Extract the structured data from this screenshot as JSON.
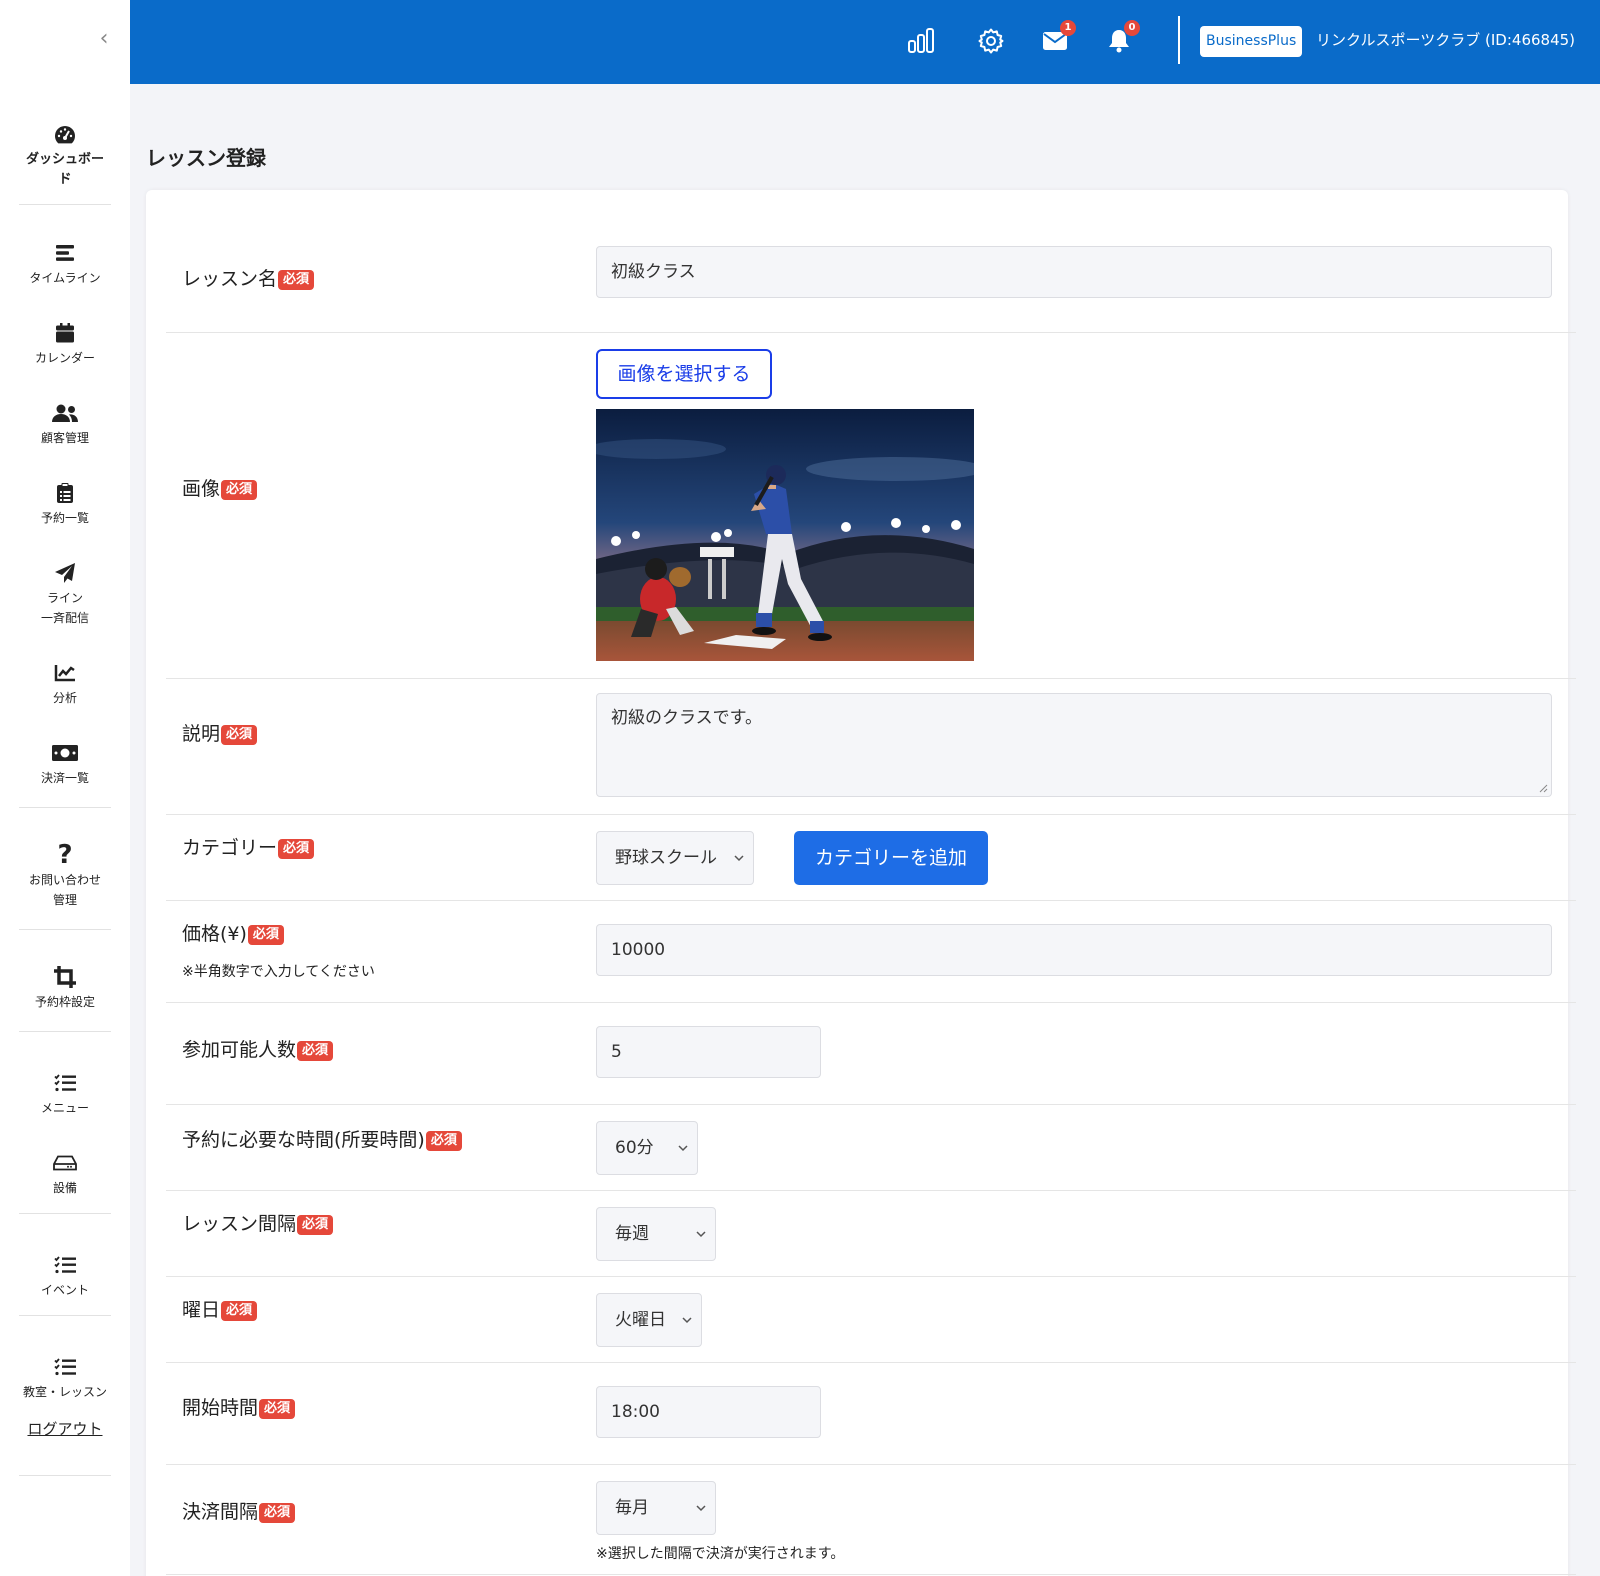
{
  "sidebar": {
    "items": [
      {
        "label": "ダッシュボード",
        "icon": "dashboard-icon"
      },
      {
        "label": "タイムライン",
        "icon": "timeline-icon"
      },
      {
        "label": "カレンダー",
        "icon": "calendar-icon"
      },
      {
        "label": "顧客管理",
        "icon": "users-icon"
      },
      {
        "label": "予約一覧",
        "icon": "clipboard-icon"
      },
      {
        "label": "ライン",
        "label2": "一斉配信",
        "icon": "paper-plane-icon"
      },
      {
        "label": "分析",
        "icon": "chart-line-icon"
      },
      {
        "label": "決済一覧",
        "icon": "money-icon"
      },
      {
        "label": "お問い合わせ",
        "label2": "管理",
        "icon": "question-icon"
      },
      {
        "label": "予約枠設定",
        "icon": "crop-icon"
      },
      {
        "label": "メニュー",
        "icon": "list-check-icon"
      },
      {
        "label": "設備",
        "icon": "hdd-icon"
      },
      {
        "label": "イベント",
        "icon": "list-check-icon"
      },
      {
        "label": "教室・レッスン",
        "icon": "list-check-icon"
      }
    ],
    "logout": "ログアウト"
  },
  "topbar": {
    "mail_count": "1",
    "notification_count": "0",
    "plan": "BusinessPlus",
    "account": "リンクルスポーツクラブ (ID:466845)"
  },
  "page": {
    "title": "レッスン登録"
  },
  "form": {
    "required_badge": "必須",
    "lesson_name": {
      "label": "レッスン名",
      "value": "初級クラス"
    },
    "image": {
      "label": "画像",
      "button": "画像を選択する"
    },
    "description": {
      "label": "説明",
      "value": "初級のクラスです。"
    },
    "category": {
      "label": "カテゴリー",
      "value": "野球スクール",
      "add_button": "カテゴリーを追加"
    },
    "price": {
      "label": "価格(¥)",
      "note": "※半角数字で入力してください",
      "value": "10000"
    },
    "capacity": {
      "label": "参加可能人数",
      "value": "5"
    },
    "duration": {
      "label": "予約に必要な時間(所要時間)",
      "value": "60分"
    },
    "interval": {
      "label": "レッスン間隔",
      "value": "毎週"
    },
    "weekday": {
      "label": "曜日",
      "value": "火曜日"
    },
    "start_time": {
      "label": "開始時間",
      "value": "18:00"
    },
    "payment_interval": {
      "label": "決済間隔",
      "value": "毎月",
      "note": "※選択した間隔で決済が実行されます。"
    }
  },
  "colors": {
    "primary": "#0a6bc9",
    "accent": "#1e6de6",
    "required": "#e5483a"
  }
}
